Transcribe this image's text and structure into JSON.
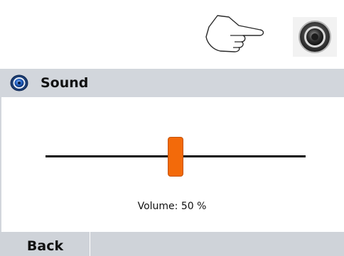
{
  "toolbar": {
    "hand_icon": "pointing-hand-icon",
    "speaker_icon": "speaker-icon"
  },
  "panel": {
    "title": "Sound",
    "title_icon": "speaker-icon"
  },
  "volume": {
    "level_fraction": 0.5,
    "label": "Volume: 50 %"
  },
  "bottom_bar": {
    "back_label": "Back"
  },
  "colors": {
    "header_bg": "#d2d6dc",
    "thumb": "#f36a0a",
    "track": "#0a0a0a",
    "bottom_bar": "#cfd3d9"
  }
}
